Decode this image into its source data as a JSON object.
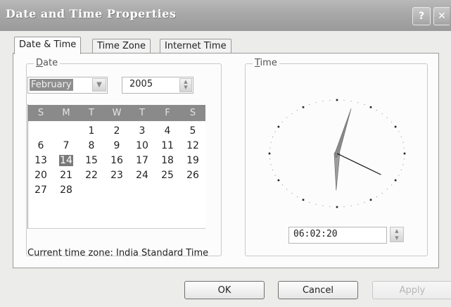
{
  "window": {
    "title": "Date and Time Properties",
    "help_glyph": "?",
    "close_glyph": "✕"
  },
  "tabs": [
    {
      "label": "Date & Time",
      "active": true
    },
    {
      "label": "Time Zone",
      "active": false
    },
    {
      "label": "Internet Time",
      "active": false
    }
  ],
  "date_group": {
    "label_prefix": "D",
    "label_rest": "ate",
    "month": "February",
    "year": "2005",
    "weekday_headers": [
      "S",
      "M",
      "T",
      "W",
      "T",
      "F",
      "S"
    ],
    "weeks": [
      [
        "",
        "",
        "1",
        "2",
        "3",
        "4",
        "5"
      ],
      [
        "6",
        "7",
        "8",
        "9",
        "10",
        "11",
        "12"
      ],
      [
        "13",
        "14",
        "15",
        "16",
        "17",
        "18",
        "19"
      ],
      [
        "20",
        "21",
        "22",
        "23",
        "24",
        "25",
        "26"
      ],
      [
        "27",
        "28",
        "",
        "",
        "",
        "",
        ""
      ]
    ],
    "selected_day": "14"
  },
  "time_group": {
    "label_prefix": "T",
    "label_rest": "ime",
    "time": "06:02:20",
    "clock": {
      "hour": 6,
      "minute": 2,
      "second": 20
    }
  },
  "status": {
    "timezone_text": "Current time zone:  India Standard Time"
  },
  "buttons": {
    "ok": "OK",
    "cancel": "Cancel",
    "apply": "Apply"
  },
  "colors": {
    "titlebar": "#a9a9a9",
    "dialog_bg": "#ececea",
    "calendar_header": "#8a8a8a",
    "selected_day_bg": "#7a7a7a"
  }
}
